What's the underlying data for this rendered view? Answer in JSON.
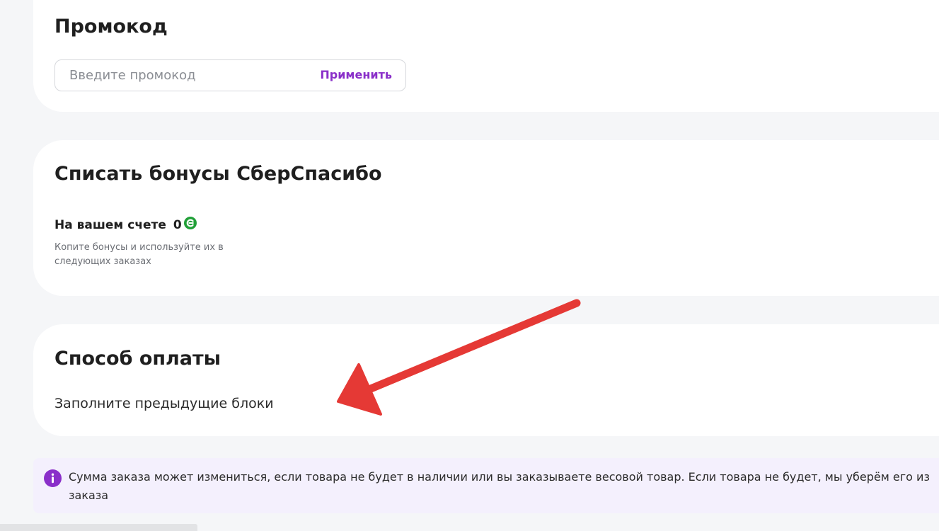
{
  "promo": {
    "title": "Промокод",
    "placeholder": "Введите промокод",
    "apply_label": "Применить"
  },
  "bonus": {
    "title": "Списать бонусы СберСпасибо",
    "balance_label": "На вашем счете",
    "balance_value": "0",
    "hint": "Копите бонусы и используйте их в следующих заказах"
  },
  "payment": {
    "title": "Способ оплаты",
    "hint": "Заполните предыдущие блоки"
  },
  "notice": {
    "text": "Сумма заказа может измениться, если товара не будет в наличии или вы заказываете весовой товар. Если товара не будет, мы уберём его из заказа"
  },
  "colors": {
    "accent": "#8a2fc9",
    "sber_green": "#21a038",
    "arrow_red": "#e53935",
    "notice_bg": "#f4f0fd"
  },
  "icons": {
    "sber": "sberspasibo-icon",
    "info": "info-icon",
    "annotation": "arrow-annotation"
  }
}
